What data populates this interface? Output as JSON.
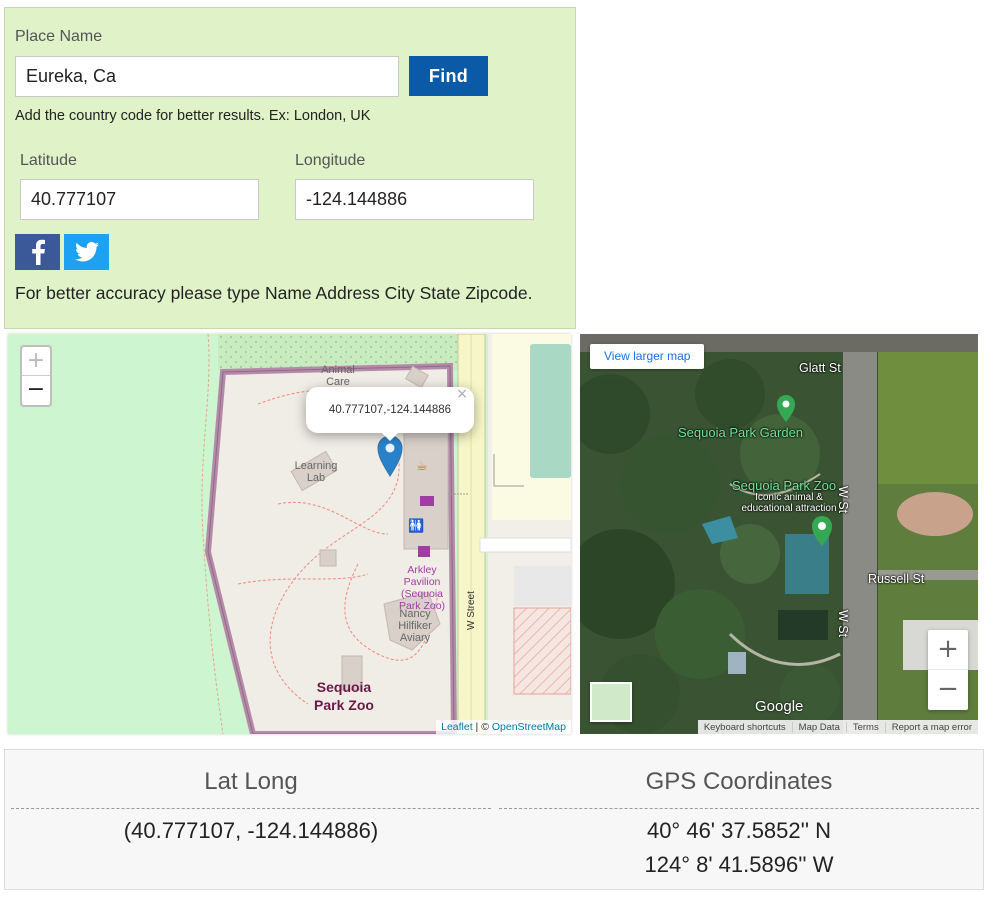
{
  "search": {
    "place_label": "Place Name",
    "place_value": "Eureka, Ca",
    "find_label": "Find",
    "hint": "Add the country code for better results. Ex: London, UK",
    "latitude_label": "Latitude",
    "latitude_value": "40.777107",
    "longitude_label": "Longitude",
    "longitude_value": "-124.144886",
    "accuracy_note": "For better accuracy please type Name Address City State Zipcode."
  },
  "osm_map": {
    "popup_text": "40.777107,-124.144886",
    "poi_animal_care": "Animal Care",
    "poi_learning_lab": "Learning Lab",
    "poi_pavilion": "Arkley Pavilion (Sequoia Park Zoo)",
    "poi_aviary": "Nancy Hilfiker Aviary",
    "area_name": "Sequoia Park Zoo",
    "street": "W Street",
    "attribution_leaflet": "Leaflet",
    "attribution_sep": " | © ",
    "attribution_osm": "OpenStreetMap",
    "colors": {
      "park": "#cdf5cf",
      "zoo_border": "#a97fa0",
      "road": "#f6f6c8",
      "water": "#a9d8c4"
    }
  },
  "satellite_map": {
    "view_larger": "View larger map",
    "glatt_st": "Glatt St",
    "garden": "Sequoia Park Garden",
    "zoo": "Sequoia Park Zoo",
    "zoo_sub": "Iconic animal & educational attraction",
    "w_st_1": "W St",
    "w_st_2": "W St",
    "russell_st": "Russell St",
    "google": "Google",
    "keyboard": "Keyboard shortcuts",
    "map_data": "Map Data",
    "terms": "Terms",
    "report": "Report a map error"
  },
  "results": {
    "latlong_heading": "Lat Long",
    "latlong_value": "(40.777107, -124.144886)",
    "gps_heading": "GPS Coordinates",
    "gps_lat": "40° 46' 37.5852'' N",
    "gps_lon": "124° 8' 41.5896'' W"
  }
}
